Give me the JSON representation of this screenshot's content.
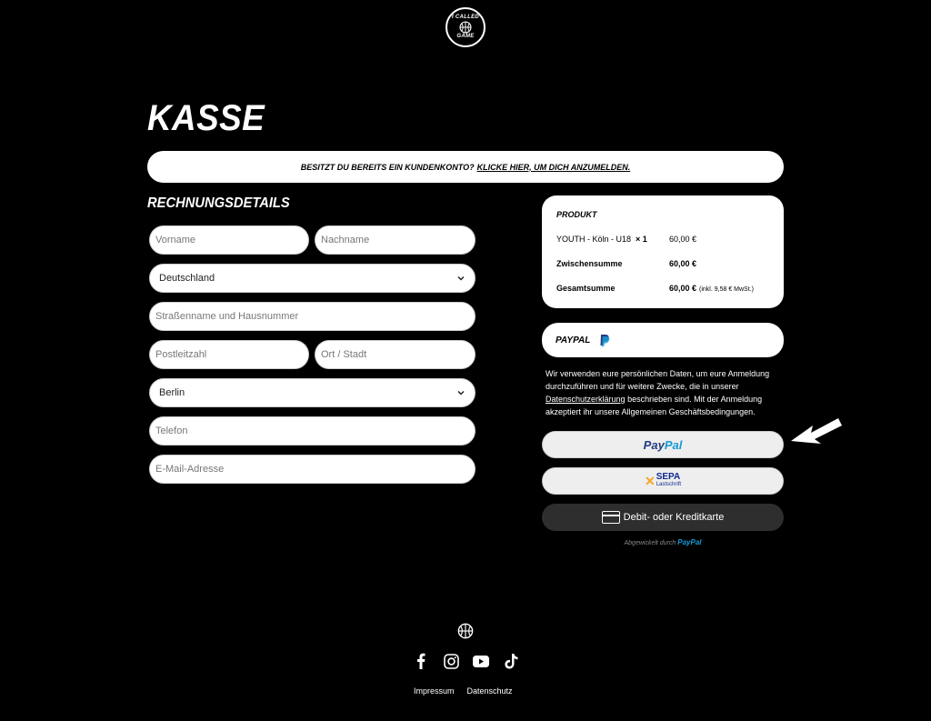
{
  "logo": {
    "lines": [
      "I CALLED",
      "GAME"
    ]
  },
  "page_title": "KASSE",
  "login_banner": {
    "question": "BESITZT DU BEREITS EIN KUNDENKONTO?",
    "link": "KLICKE HIER, UM DICH ANZUMELDEN."
  },
  "billing": {
    "title": "RECHNUNGSDETAILS",
    "fields": {
      "first_name": "Vorname",
      "last_name": "Nachname",
      "country": "Deutschland",
      "street": "Straßenname und Hausnummer",
      "postcode": "Postleitzahl",
      "city": "Ort / Stadt",
      "state": "Berlin",
      "phone": "Telefon",
      "email": "E-Mail-Adresse"
    }
  },
  "order": {
    "header": "PRODUKT",
    "product_name": "YOUTH - Köln - U18",
    "product_qty": "× 1",
    "product_price": "60,00 €",
    "subtotal_label": "Zwischensumme",
    "subtotal_value": "60,00 €",
    "total_label": "Gesamtsumme",
    "total_value": "60,00 €",
    "total_tax": "(inkl. 9,58 € MwSt.)"
  },
  "payment": {
    "method_label": "PAYPAL",
    "privacy_before": "Wir verwenden eure persönlichen Daten, um eure Anmeldung durchzuführen und für weitere Zwecke, die in unserer ",
    "privacy_link": "Datenschutzerklärung",
    "privacy_after": " beschrieben sind. Mit der Anmeldung akzeptiert ihr unsere Allgemeinen Geschäftsbedingungen.",
    "paypal_btn_p1": "Pay",
    "paypal_btn_p2": "Pal",
    "sepa_main": "SEPA",
    "sepa_sub": "Lastschrift",
    "card_btn": "Debit- oder Kreditkarte",
    "powered_by": "Abgewickelt durch",
    "powered_brand": "PayPal"
  },
  "footer": {
    "links": [
      "Impressum",
      "Datenschutz"
    ]
  },
  "colors": {
    "background": "#000000",
    "paypal_dark": "#253b80",
    "paypal_light": "#179bd7",
    "sepa_blue": "#10298e"
  }
}
